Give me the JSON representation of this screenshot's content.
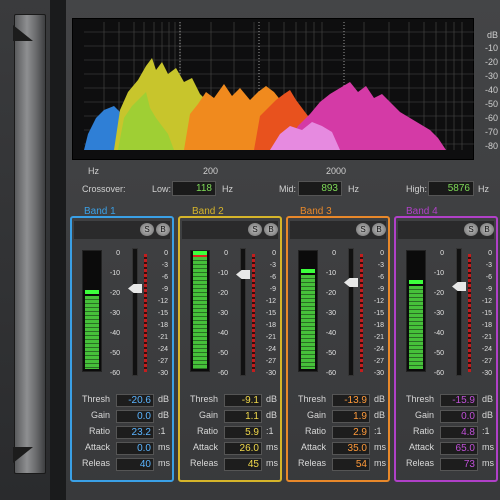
{
  "db_scale": [
    "dB",
    "-10",
    "-20",
    "-30",
    "-40",
    "-50",
    "-60",
    "-70",
    "-80"
  ],
  "freq_labels": {
    "hz": "Hz",
    "f200": "200",
    "f2000": "2000"
  },
  "crossover": {
    "label": "Crossover:",
    "low_label": "Low:",
    "low_value": "118",
    "low_unit": "Hz",
    "mid_label": "Mid:",
    "mid_value": "893",
    "mid_unit": "Hz",
    "high_label": "High:",
    "high_value": "5876",
    "high_unit": "Hz"
  },
  "scale_left": [
    "0",
    "-10",
    "-20",
    "-30",
    "-40",
    "-50",
    "-60"
  ],
  "scale_right": [
    "0",
    "-3",
    "-6",
    "-9",
    "-12",
    "-15",
    "-18",
    "-21",
    "-24",
    "-27",
    "-30"
  ],
  "param_labels": {
    "thresh": "Thresh",
    "gain": "Gain",
    "ratio": "Ratio",
    "attack": "Attack",
    "release": "Releas"
  },
  "param_units": {
    "thresh": "dB",
    "gain": "dB",
    "ratio": ":1",
    "attack": "ms",
    "release": "ms"
  },
  "solo_label": "S",
  "bypass_label": "B",
  "bands": [
    {
      "name": "Band 1",
      "color": "#3aa0e6",
      "value_color": "#5ab4ff",
      "level": 0.62,
      "thresh_pos": 0.3,
      "thresh": "-20.6",
      "gain": "0.0",
      "ratio": "23.2",
      "attack": "0.0",
      "release": "40"
    },
    {
      "name": "Band 2",
      "color": "#d6b52a",
      "value_color": "#f0d84a",
      "level": 0.95,
      "thresh_pos": 0.18,
      "thresh": "-9.1",
      "gain": "1.1",
      "ratio": "5.9",
      "attack": "26.0",
      "release": "45"
    },
    {
      "name": "Band 3",
      "color": "#e8882a",
      "value_color": "#ff9a3a",
      "level": 0.8,
      "thresh_pos": 0.25,
      "thresh": "-13.9",
      "gain": "1.9",
      "ratio": "2.9",
      "attack": "35.0",
      "release": "54"
    },
    {
      "name": "Band 4",
      "color": "#b040c8",
      "value_color": "#c050d8",
      "level": 0.7,
      "thresh_pos": 0.28,
      "thresh": "-15.9",
      "gain": "0.0",
      "ratio": "4.8",
      "attack": "65.0",
      "release": "73"
    }
  ]
}
